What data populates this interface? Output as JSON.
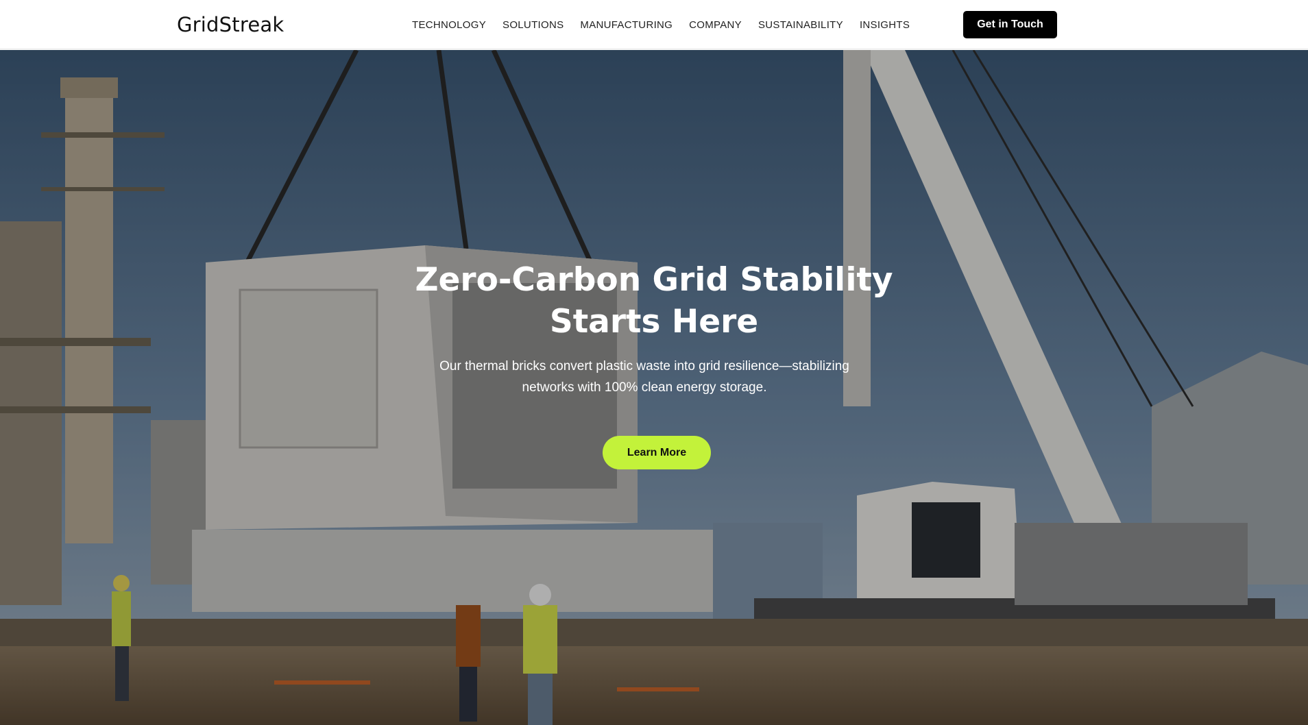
{
  "header": {
    "logo": "GridStreak",
    "nav": [
      "TECHNOLOGY",
      "SOLUTIONS",
      "MANUFACTURING",
      "COMPANY",
      "SUSTAINABILITY",
      "INSIGHTS"
    ],
    "cta_label": "Get in Touch"
  },
  "hero": {
    "title": "Zero-Carbon Grid Stability\nStarts Here",
    "subtitle": "Our thermal bricks convert plastic waste into grid resilience—stabilizing\nnetworks with 100% clean energy storage.",
    "cta_label": "Learn More",
    "cta_color": "#c3f23a"
  }
}
